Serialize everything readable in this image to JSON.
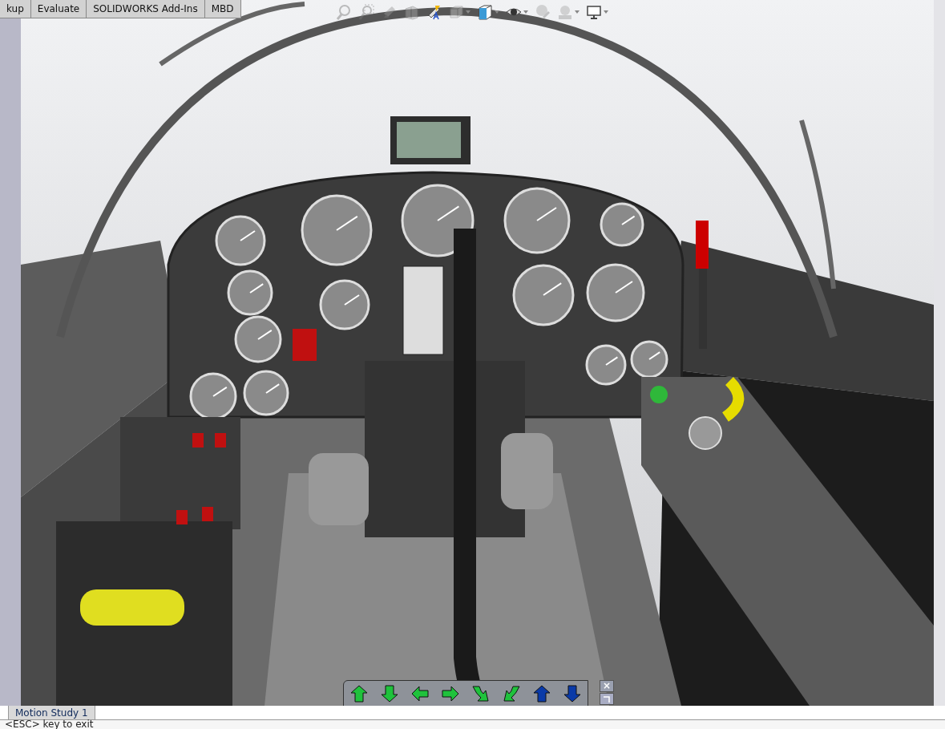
{
  "command_tabs": [
    {
      "label": "kup",
      "selected": false
    },
    {
      "label": "Evaluate",
      "selected": false
    },
    {
      "label": "SOLIDWORKS Add-Ins",
      "selected": false
    },
    {
      "label": "MBD",
      "selected": false
    }
  ],
  "view_toolbar": [
    {
      "kind": "zoomfit",
      "disabled": true,
      "dropdown": false
    },
    {
      "kind": "zoomarea",
      "disabled": true,
      "dropdown": false
    },
    {
      "kind": "previous",
      "disabled": true,
      "dropdown": false
    },
    {
      "kind": "section",
      "disabled": true,
      "dropdown": false
    },
    {
      "kind": "annotation",
      "disabled": false,
      "dropdown": false
    },
    {
      "kind": "orientation",
      "disabled": true,
      "dropdown": true
    },
    {
      "kind": "displaystyle",
      "disabled": false,
      "dropdown": true
    },
    {
      "kind": "hideshow",
      "disabled": false,
      "dropdown": true
    },
    {
      "kind": "appearance",
      "disabled": true,
      "dropdown": false
    },
    {
      "kind": "scene",
      "disabled": true,
      "dropdown": true
    },
    {
      "kind": "monitor",
      "disabled": false,
      "dropdown": true
    }
  ],
  "walkthrough_toolbar": {
    "buttons": [
      {
        "kind": "up",
        "color": "#1fc23c"
      },
      {
        "kind": "down",
        "color": "#1fc23c"
      },
      {
        "kind": "left",
        "color": "#1fc23c"
      },
      {
        "kind": "right",
        "color": "#1fc23c"
      },
      {
        "kind": "turnright",
        "color": "#1fc23c"
      },
      {
        "kind": "turnleft",
        "color": "#1fc23c"
      },
      {
        "kind": "up",
        "color": "#0a3aa8"
      },
      {
        "kind": "down",
        "color": "#0a3aa8"
      }
    ],
    "close": "×"
  },
  "bottom_tabs": [
    {
      "label": "Motion Study 1",
      "selected": true
    }
  ],
  "status_bar": "<ESC> key to exit"
}
